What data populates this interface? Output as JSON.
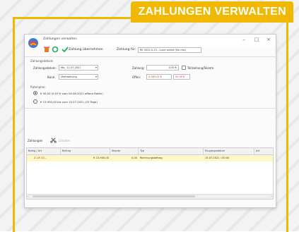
{
  "banner": {
    "title": "ZAHLUNGEN VERWALTEN"
  },
  "window": {
    "title": "Zahlungen verwalten",
    "controls": {
      "minimize": "–",
      "maximize": "□",
      "close": "×"
    }
  },
  "toolbar": {
    "delete_icon": "trash-icon",
    "refresh_icon": "refresh-icon",
    "accept_label": "Zahlung übernehmen",
    "account_label": "Zahlung für:",
    "account_value": "RE 2021-0-13 - Lucie online (Sie rels)"
  },
  "details": {
    "group_label": "Zahlungsdetails",
    "date_label": "Zahlungsdatum:",
    "date_value": "Mo., 11.07.2021",
    "amount_label": "Zahlung:",
    "amount_value": "0,00 €",
    "discount_label": "Teilzahlung/Skonto",
    "bank_label": "Bank:",
    "bank_value": "Überweisung",
    "offen_label": "Offen:",
    "offen_value": "4.363,41 €",
    "offen_value2": "50,00 €"
  },
  "reminder": {
    "group_label": "Ratenplan:",
    "options": [
      {
        "text": "€ 50,00 (0,03 € vom 04.08.2021 offene Raten)",
        "selected": true
      },
      {
        "text": "€ 13.900,00 bis zum 15.07.2021 (33 Tage)",
        "selected": false
      }
    ]
  },
  "payments": {
    "label": "Zahlungen",
    "delete_label": "Löschen",
    "columns": [
      "Beleg / Art",
      "Betrag",
      "Skonto",
      "Typ",
      "Eingangsdatum",
      "Art"
    ],
    "rows": [
      {
        "beleg": "Z-LIF-33...",
        "betrag": "€ 13.900,00",
        "skonto": "0,00",
        "typ": "Rechnungsbetrag",
        "datum": "15.07.2021 / 00:00",
        "art": ""
      }
    ]
  },
  "colors": {
    "accent": "#f0b800",
    "row_highlight": "#fff7c6",
    "negative": "#c0392b"
  }
}
